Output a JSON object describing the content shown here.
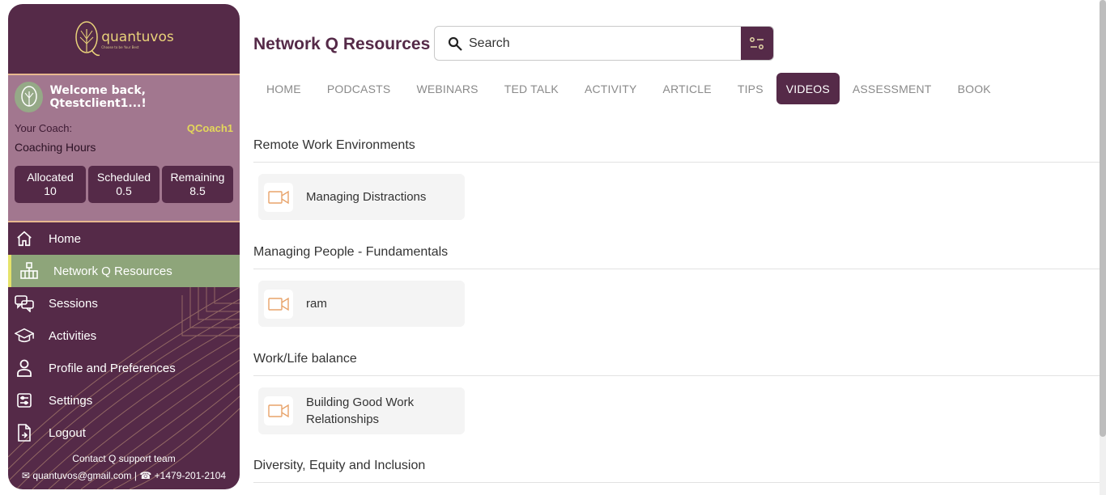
{
  "brand": {
    "name": "quantuvos",
    "tagline": "Choose to be Your Best"
  },
  "profile": {
    "welcome": "Welcome back, Qtestclient1...!",
    "coach_label": "Your Coach:",
    "coach_name": "QCoach1",
    "hours_title": "Coaching Hours",
    "hours": [
      {
        "label": "Allocated",
        "value": "10"
      },
      {
        "label": "Scheduled",
        "value": "0.5"
      },
      {
        "label": "Remaining",
        "value": "8.5"
      }
    ]
  },
  "nav": {
    "items": [
      {
        "label": "Home",
        "icon": "home-icon"
      },
      {
        "label": "Network Q Resources",
        "icon": "network-icon"
      },
      {
        "label": "Sessions",
        "icon": "chat-icon"
      },
      {
        "label": "Activities",
        "icon": "graduation-cap-icon"
      },
      {
        "label": "Profile and Preferences",
        "icon": "user-icon"
      },
      {
        "label": "Settings",
        "icon": "settings-icon"
      },
      {
        "label": "Logout",
        "icon": "logout-icon"
      }
    ],
    "active_index": 1
  },
  "contact": {
    "title": "Contact Q support team",
    "email": "quantuvos@gmail.com",
    "separator": "|",
    "phone": "+1479-201-2104"
  },
  "main": {
    "title": "Network Q Resources",
    "search_placeholder": "Search",
    "tabs": [
      "HOME",
      "PODCASTS",
      "WEBINARS",
      "TED TALK",
      "ACTIVITY",
      "ARTICLE",
      "TIPS",
      "VIDEOS",
      "ASSESSMENT",
      "BOOK"
    ],
    "active_tab": "VIDEOS",
    "sections": [
      {
        "title": "Remote Work Environments",
        "items": [
          "Managing Distractions"
        ]
      },
      {
        "title": "Managing People - Fundamentals",
        "items": [
          "ram"
        ]
      },
      {
        "title": "Work/Life balance",
        "items": [
          "Building Good Work Relationships"
        ]
      },
      {
        "title": "Diversity, Equity and Inclusion",
        "items": []
      }
    ]
  },
  "colors": {
    "primary": "#552a48",
    "profile_bg": "#a2778f",
    "active_nav": "#8ea57a",
    "accent_yellow": "#e4d75a",
    "video_icon": "#e8a36a"
  }
}
